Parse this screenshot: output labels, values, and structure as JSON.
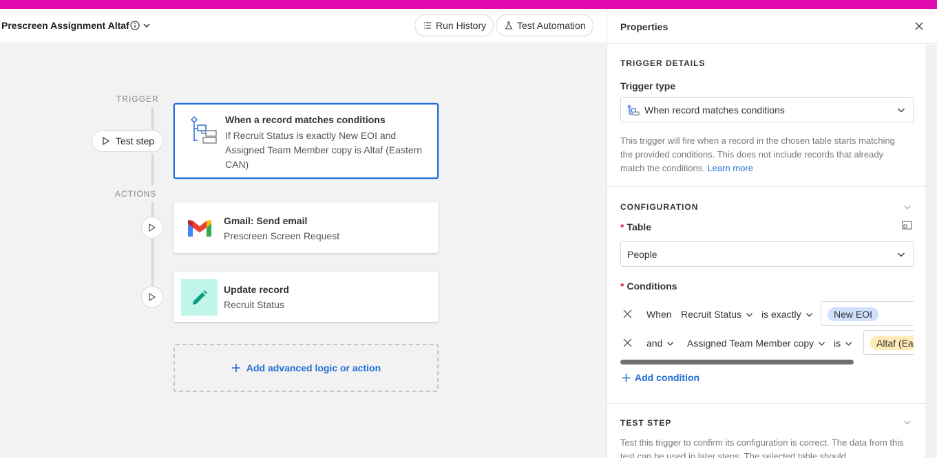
{
  "header": {
    "title": "Prescreen Assignment Altaf",
    "run_history": "Run History",
    "test_automation": "Test Automation"
  },
  "canvas": {
    "trigger_label": "TRIGGER",
    "actions_label": "ACTIONS",
    "test_step": "Test step",
    "trigger_card": {
      "title": "When a record matches conditions",
      "desc": "If Recruit Status is exactly New EOI and Assigned Team Member copy is Altaf (Eastern CAN)"
    },
    "actions": [
      {
        "title": "Gmail: Send email",
        "desc": "Prescreen Screen Request"
      },
      {
        "title": "Update record",
        "desc": "Recruit Status"
      }
    ],
    "add_logic": "Add advanced logic or action"
  },
  "panel": {
    "title": "Properties",
    "trigger_details": {
      "label": "TRIGGER DETAILS",
      "trigger_type_label": "Trigger type",
      "trigger_type_value": "When record matches conditions",
      "help": "This trigger will fire when a record in the chosen table starts matching the provided conditions. This does not include records that already match the conditions.",
      "learn_more": "Learn more"
    },
    "configuration": {
      "label": "CONFIGURATION",
      "table_label": "Table",
      "table_value": "People",
      "conditions_label": "Conditions",
      "conditions": [
        {
          "conj": "When",
          "field": "Recruit Status",
          "op": "is exactly",
          "value": "New EOI"
        },
        {
          "conj": "and",
          "field": "Assigned Team Member copy",
          "op": "is",
          "value": "Altaf (Eas"
        }
      ],
      "add_condition": "Add condition"
    },
    "test_step": {
      "label": "TEST STEP",
      "help": "Test this trigger to confirm its configuration is correct. The data from this test can be used in later steps. The selected table should"
    }
  },
  "colors": {
    "topbar": "#e40ab2",
    "accent": "#1f6fd6",
    "pill_blue": "#cfe0fc",
    "pill_yellow": "#ffeab6",
    "update_icon_bg": "#c2f5e9",
    "update_icon_fg": "#0b9c85"
  }
}
